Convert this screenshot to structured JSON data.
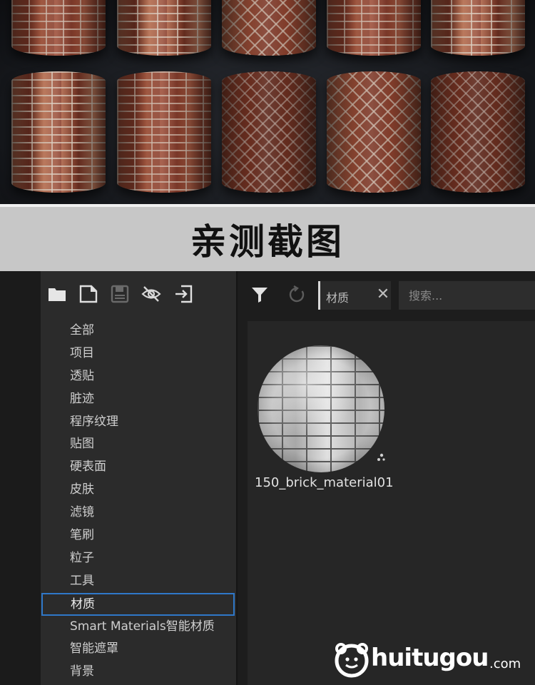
{
  "banner": {
    "title": "亲测截图"
  },
  "toolbar": {
    "folder_icon": "folder-icon",
    "new_file_icon": "new-file-icon",
    "save_icon": "save-icon",
    "hidden_icon": "eye-off-icon",
    "import_icon": "import-icon"
  },
  "sidebar": {
    "items": [
      {
        "label": "全部"
      },
      {
        "label": "项目"
      },
      {
        "label": "透贴"
      },
      {
        "label": "脏迹"
      },
      {
        "label": "程序纹理"
      },
      {
        "label": "贴图"
      },
      {
        "label": "硬表面"
      },
      {
        "label": "皮肤"
      },
      {
        "label": "滤镜"
      },
      {
        "label": "笔刷"
      },
      {
        "label": "粒子"
      },
      {
        "label": "工具"
      },
      {
        "label": "材质",
        "selected": true
      },
      {
        "label": "Smart Materials智能材质"
      },
      {
        "label": "智能遮罩"
      },
      {
        "label": "背景"
      }
    ],
    "selected_color": "#2f78c9"
  },
  "filter_bar": {
    "active_tag": "材质",
    "close_glyph": "✕",
    "search_placeholder": "搜索..."
  },
  "assets": [
    {
      "name": "150_brick_material01"
    }
  ],
  "watermark": {
    "text": "huitugou",
    "suffix": ".com"
  }
}
